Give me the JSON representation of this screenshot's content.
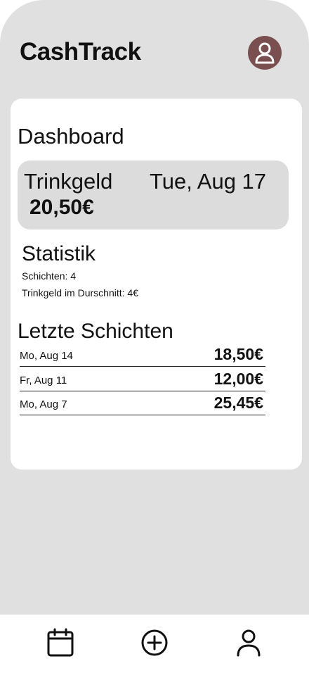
{
  "header": {
    "app_title": "CashTrack",
    "avatar_icon": "user-avatar-icon",
    "avatar_color": "#7a4f4f"
  },
  "dashboard": {
    "title": "Dashboard",
    "tip": {
      "label": "Trinkgeld",
      "date": "Tue, Aug 17",
      "amount": "20,50€"
    },
    "stats": {
      "title": "Statistik",
      "shifts": "Schichten: 4",
      "avg_tip": "Trinkgeld im Durschnitt: 4€"
    },
    "recent": {
      "title": "Letzte Schichten",
      "rows": [
        {
          "date": "Mo, Aug 14",
          "amount": "18,50€"
        },
        {
          "date": "Fr, Aug 11",
          "amount": "12,00€"
        },
        {
          "date": "Mo, Aug 7",
          "amount": "25,45€"
        }
      ]
    }
  },
  "nav": {
    "items": [
      {
        "icon": "calendar-icon"
      },
      {
        "icon": "plus-circle-icon"
      },
      {
        "icon": "user-icon"
      }
    ]
  }
}
